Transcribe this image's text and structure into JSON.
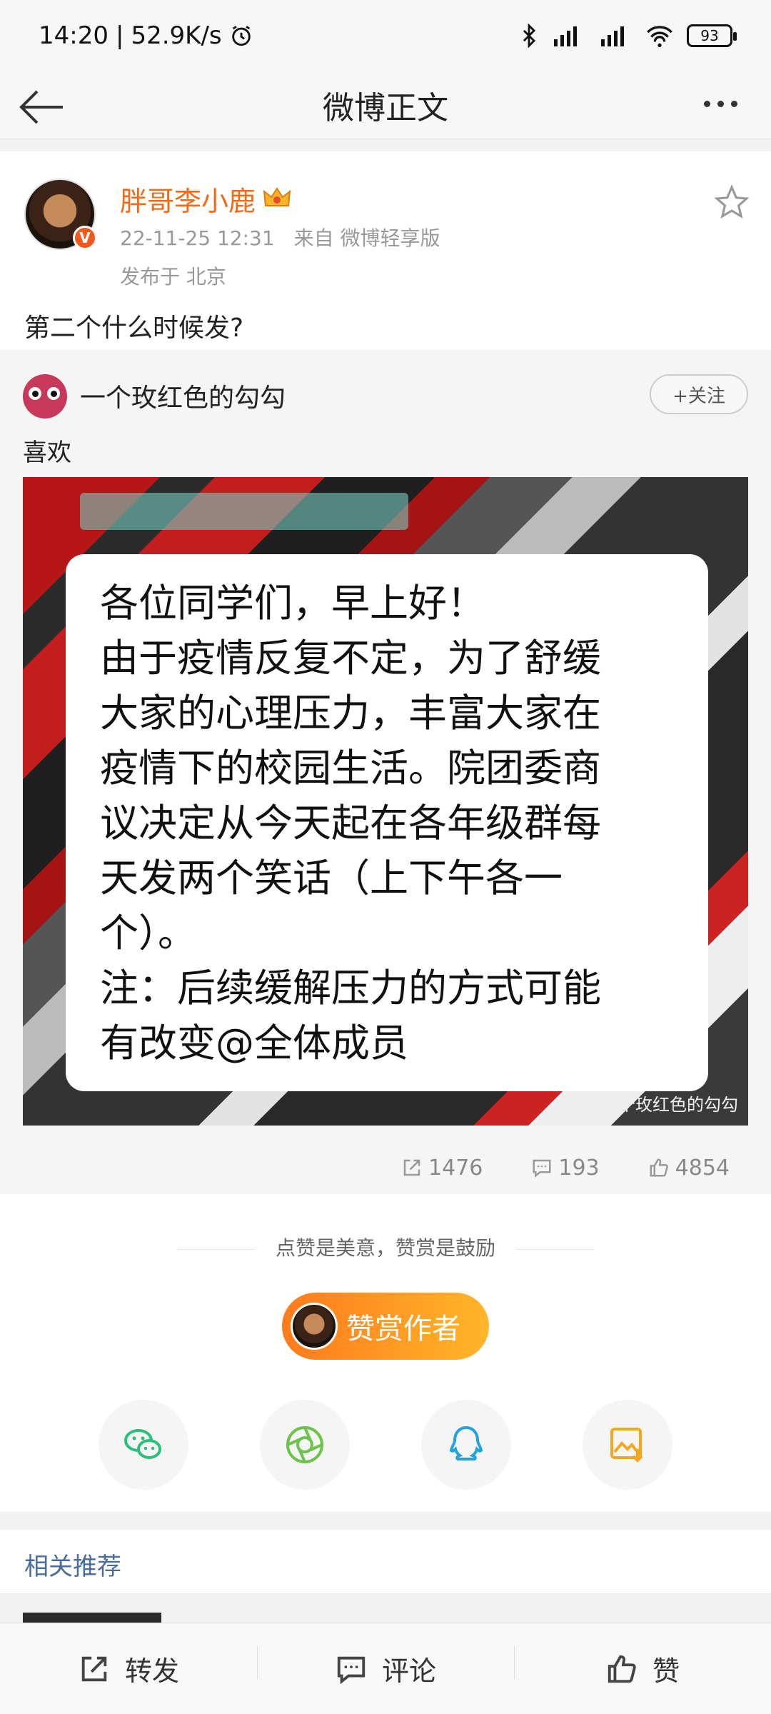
{
  "status": {
    "time": "14:20",
    "speed": "52.9K/s",
    "battery": "93"
  },
  "header": {
    "title": "微博正文"
  },
  "post": {
    "author": "胖哥李小鹿",
    "verified_badge": "V",
    "timestamp": "22-11-25 12:31",
    "source": "来自 微博轻享版",
    "location": "发布于 北京",
    "text": "第二个什么时候发?"
  },
  "repost": {
    "author": "一个玫红色的勾勾",
    "follow_label": "+关注",
    "text": "喜欢",
    "image_lines": [
      "各位同学们，早上好！",
      "由于疫情反复不定，为了舒缓",
      "大家的心理压力，丰富大家在",
      "疫情下的校园生活。院团委商",
      "议决定从今天起在各年级群每",
      "天发两个笑话（上下午各一",
      "个）。",
      "注：后续缓解压力的方式可能",
      "有改变@全体成员"
    ],
    "watermark": "@一个玫红色的勾勾",
    "stats": {
      "reposts": "1476",
      "comments": "193",
      "likes": "4854"
    }
  },
  "reward": {
    "slogan": "点赞是美意，赞赏是鼓励",
    "button_label": "赞赏作者"
  },
  "share_icons": [
    "wechat-icon",
    "moments-icon",
    "qq-icon",
    "save-image-icon"
  ],
  "related": {
    "title": "相关推荐"
  },
  "bottom_bar": {
    "repost": "转发",
    "comment": "评论",
    "like": "赞"
  },
  "colors": {
    "author_orange": "#f26a17",
    "link_blue": "#4a6c9b",
    "reward_gradient_start": "#ff7a1c",
    "reward_gradient_end": "#ffb62a"
  }
}
